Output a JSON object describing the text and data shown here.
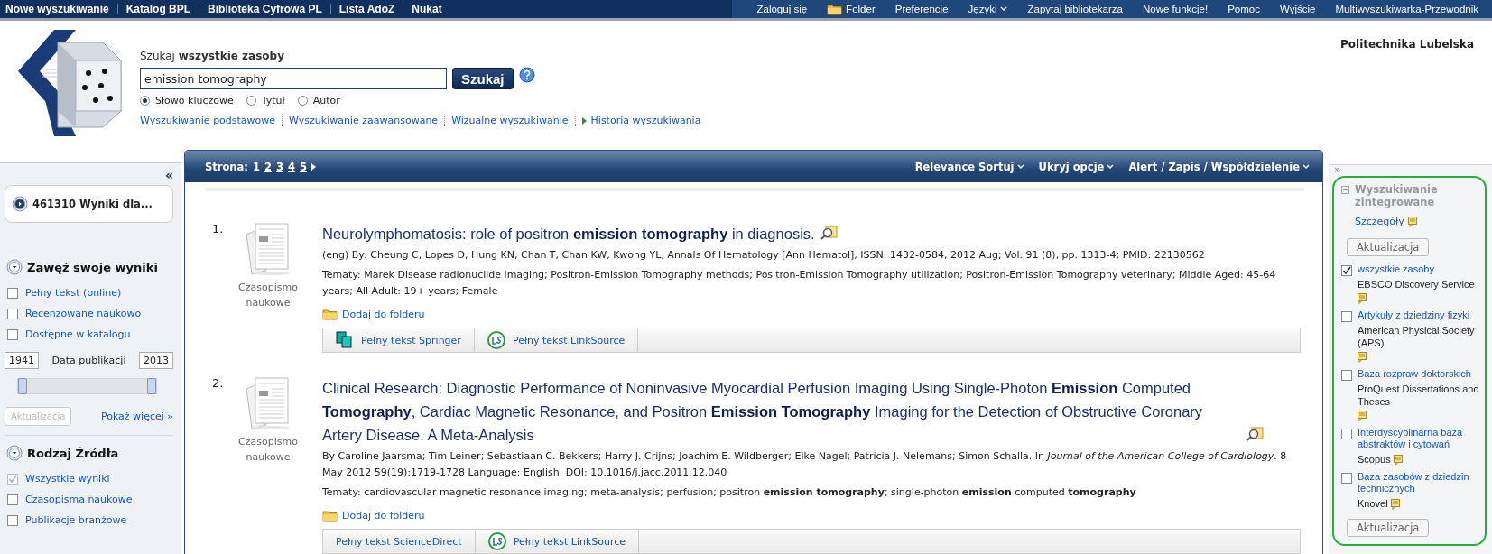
{
  "top_nav": {
    "left": [
      {
        "label": "Nowe wyszukiwanie"
      },
      {
        "label": "Katalog BPL"
      },
      {
        "label": "Biblioteka Cyfrowa PL"
      },
      {
        "label": "Lista AdoZ"
      },
      {
        "label": "Nukat"
      }
    ],
    "right": [
      {
        "label": "Zaloguj się",
        "kind": "link"
      },
      {
        "label": "Folder",
        "kind": "folder"
      },
      {
        "label": "Preferencje",
        "kind": "link"
      },
      {
        "label": "Języki",
        "kind": "menu"
      },
      {
        "label": "Zapytaj bibliotekarza",
        "kind": "link"
      },
      {
        "label": "Nowe funkcje!",
        "kind": "link"
      },
      {
        "label": "Pomoc",
        "kind": "link"
      },
      {
        "label": "Wyjście",
        "kind": "link"
      },
      {
        "label": "Multiwyszukiwarka-Przewodnik",
        "kind": "link"
      }
    ]
  },
  "header": {
    "institution": "Politechnika Lubelska",
    "search_label": "Szukaj",
    "search_scope": "wszystkie zasoby",
    "query": "emission tomography",
    "search_button": "Szukaj",
    "options": [
      {
        "label": "Słowo kluczowe",
        "selected": true
      },
      {
        "label": "Tytuł",
        "selected": false
      },
      {
        "label": "Autor",
        "selected": false
      }
    ],
    "links": [
      {
        "label": "Wyszukiwanie podstawowe",
        "kind": "link"
      },
      {
        "label": "Wyszukiwanie zaawansowane",
        "kind": "link"
      },
      {
        "label": "Wizualne wyszukiwanie",
        "kind": "link"
      },
      {
        "label": "Historia wyszukiwania",
        "kind": "expand"
      }
    ]
  },
  "left_sidebar": {
    "collapse": "«",
    "results_summary": "461310 Wyniki dla...",
    "refine": {
      "title": "Zawęź swoje wyniki",
      "filters": [
        {
          "label": "Pełny tekst (online)",
          "checked": false
        },
        {
          "label": "Recenzowane naukowo",
          "checked": false
        },
        {
          "label": "Dostępne w katalogu",
          "checked": false
        }
      ],
      "date_from": "1941",
      "date_label": "Data publikacji",
      "date_to": "2013",
      "slider_start": {
        "level": 0
      },
      "slider_end": {
        "level": 1
      },
      "update_button": {
        "label": "Aktualizacja",
        "disabled": true
      },
      "more_link": "Pokaż więcej »"
    },
    "source_type": {
      "title": "Rodzaj Źródła",
      "filters": [
        {
          "label": "Wszystkie wyniki",
          "checked": true,
          "disabled": true
        },
        {
          "label": "Czasopisma naukowe",
          "checked": false,
          "disabled": false
        },
        {
          "label": "Publikacje branżowe",
          "checked": false,
          "disabled": false
        }
      ]
    }
  },
  "results": {
    "toolbar": {
      "page_label": "Strona:",
      "pages": [
        {
          "label": "1",
          "selected": true
        },
        {
          "label": "2",
          "selected": false
        },
        {
          "label": "3",
          "selected": false
        },
        {
          "label": "4",
          "selected": false
        },
        {
          "label": "5",
          "selected": false
        }
      ],
      "menus": [
        "Relevance Sortuj",
        "Ukryj opcje",
        "Alert / Zapis / Współdzielenie"
      ]
    },
    "items": [
      {
        "number": "1.",
        "type_label": "Czasopismo naukowe",
        "title": "Neurolymphomatosis: role of positron **emission tomography** in diagnosis.",
        "meta": "(eng) By: Cheung C, Lopes D, Hung KN, Chan T, Chan KW, Kwong YL, Annals Of Hematology [Ann Hematol], ISSN: 1432-0584, 2012 Aug; Vol. 91 (8), pp. 1313-4; PMID: 22130562",
        "subjects": "Tematy: Marek Disease radionuclide imaging; Positron-Emission Tomography methods; Positron-Emission Tomography utilization; Positron-Emission Tomography veterinary; Middle Aged: 45-64 years; All Adult: 19+ years; Female",
        "add_folder": "Dodaj do folderu",
        "links": [
          {
            "label": "Pełny tekst Springer",
            "kind": "springer"
          },
          {
            "label": "Pełny tekst LinkSource",
            "kind": "linksource"
          }
        ]
      },
      {
        "number": "2.",
        "type_label": "Czasopismo naukowe",
        "title": "Clinical Research: Diagnostic Performance of Noninvasive Myocardial Perfusion Imaging Using Single-Photon **Emission** Computed **Tomography**, Cardiac Magnetic Resonance, and Positron **Emission Tomography** Imaging for the Detection of Obstructive Coronary Artery Disease. A Meta-Analysis",
        "meta": "By Caroline Jaarsma; Tim Leiner; Sebastiaan C. Bekkers; Harry J. Crijns; Joachim E. Wildberger; Eike Nagel; Patricia J. Nelemans; Simon Schalla. In *Journal of the American College of Cardiology*. 8 May 2012 59(19):1719-1728 Language: English. DOI: 10.1016/j.jacc.2011.12.040",
        "subjects": "Tematy: cardiovascular magnetic resonance imaging; meta-analysis; perfusion; positron **emission tomography**; single-photon **emission** computed **tomography**",
        "add_folder": "Dodaj do folderu",
        "links": [
          {
            "label": "Pełny tekst ScienceDirect",
            "kind": "plain"
          },
          {
            "label": "Pełny tekst LinkSource",
            "kind": "linksource"
          }
        ]
      }
    ]
  },
  "right_sidebar": {
    "expand": "»",
    "title": "Wyszukiwanie zintegrowane",
    "details": "Szczegóły",
    "update_button": "Aktualizacja",
    "sources": [
      {
        "label": "wszystkie zasoby",
        "provider": "EBSCO Discovery Service",
        "checked": true
      },
      {
        "label": "Artykuły z dziedziny fizyki",
        "provider": "American Physical Society (APS)",
        "checked": false
      },
      {
        "label": "Baza rozpraw doktorskich",
        "provider": "ProQuest Dissertations and Theses",
        "checked": false
      },
      {
        "label": "Interdyscyplinarna baza abstraktów i cytowań",
        "provider": "Scopus",
        "checked": false
      },
      {
        "label": "Baza zasobów z dziedzin technicznych",
        "provider": "Knovel",
        "checked": false
      }
    ],
    "update_button_bottom": "Aktualizacja"
  }
}
